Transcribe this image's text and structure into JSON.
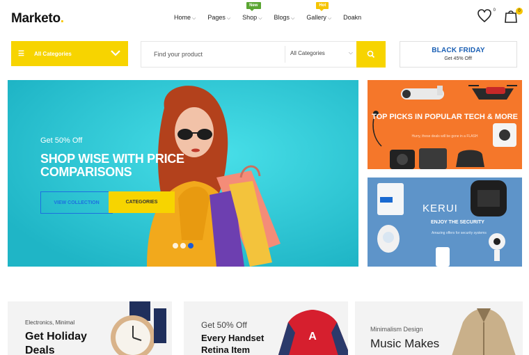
{
  "brand": {
    "name": "Marketo",
    "dot": "."
  },
  "nav": {
    "items": [
      {
        "label": "Home",
        "badge": ""
      },
      {
        "label": "Pages",
        "badge": ""
      },
      {
        "label": "Shop",
        "badge": "New"
      },
      {
        "label": "Blogs",
        "badge": ""
      },
      {
        "label": "Gallery",
        "badge": "Hot"
      },
      {
        "label": "Doakn",
        "badge": ""
      }
    ]
  },
  "header_icons": {
    "wishlist_count": "0",
    "cart_count": "0"
  },
  "categories_button": {
    "label": "All Categories"
  },
  "search": {
    "placeholder": "Find your product",
    "category_value": "All Categories"
  },
  "promo_box": {
    "title": "BLACK FRIDAY",
    "subtitle": "Get 45% Off!"
  },
  "hero": {
    "subtitle": "Get 50% Off",
    "title": "SHOP WISE WITH PRICE COMPARISONS",
    "view_button": "VIEW COLLECTION",
    "categories_button": "CATEGORIES",
    "slides": 3,
    "active_slide": 3
  },
  "banner_tech": {
    "title": "TOP PICKS IN POPULAR TECH & MORE",
    "subtitle": "Hurry, these deals will be gone in a FLASH"
  },
  "banner_security": {
    "brand": "KERUI",
    "title": "ENJOY THE SECURITY",
    "subtitle": "Amazing offers for security systems"
  },
  "cards": [
    {
      "eyebrow": "Electronics, Minimal",
      "title": "Get Holiday Deals"
    },
    {
      "eyebrow": "Get 50% Off",
      "title": "Every Handset Retina Item"
    },
    {
      "eyebrow": "Minimalism Design",
      "title": "Music Makes"
    }
  ],
  "colors": {
    "accent": "#f7d400",
    "hero_bg": "#27c3d3",
    "orange_banner": "#f5772a",
    "blue_banner": "#5e94c9",
    "link_blue": "#1c6fe0"
  }
}
